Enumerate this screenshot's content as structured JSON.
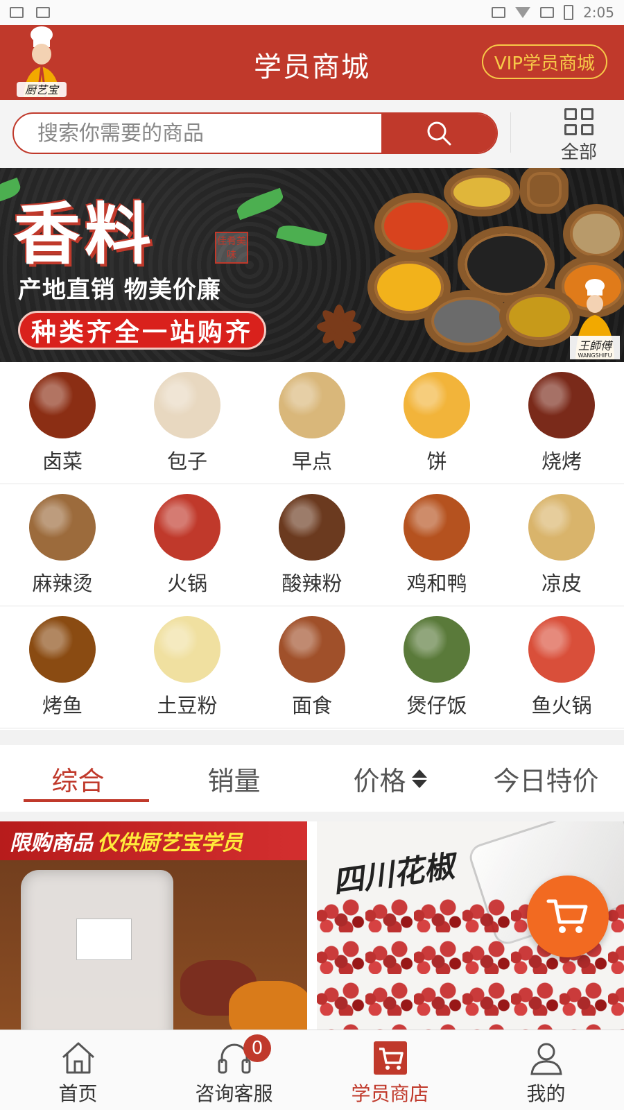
{
  "status_bar": {
    "time": "2:05"
  },
  "header": {
    "title": "学员商城",
    "vip_label": "VIP学员商城",
    "logo_text": "厨艺宝"
  },
  "search": {
    "placeholder": "搜索你需要的商品",
    "all_label": "全部"
  },
  "banner": {
    "title": "香料",
    "seal": "佳肴美味",
    "subtitle": "产地直销 物美价廉",
    "ribbon": "种类齐全一站购齐",
    "brand": "王師傅",
    "brand_en": "WANGSHIFU"
  },
  "categories": [
    [
      {
        "label": "卤菜",
        "color": "#8b2e14"
      },
      {
        "label": "包子",
        "color": "#e8d8c0"
      },
      {
        "label": "早点",
        "color": "#d9b77a"
      },
      {
        "label": "饼",
        "color": "#f2b43a"
      },
      {
        "label": "烧烤",
        "color": "#7a2a1a"
      }
    ],
    [
      {
        "label": "麻辣烫",
        "color": "#9c6b3c"
      },
      {
        "label": "火锅",
        "color": "#c0392b"
      },
      {
        "label": "酸辣粉",
        "color": "#6b3a1f"
      },
      {
        "label": "鸡和鸭",
        "color": "#b5521f"
      },
      {
        "label": "凉皮",
        "color": "#d9b46b"
      }
    ],
    [
      {
        "label": "烤鱼",
        "color": "#8a4b12"
      },
      {
        "label": "土豆粉",
        "color": "#f0e0a0"
      },
      {
        "label": "面食",
        "color": "#a0502a"
      },
      {
        "label": "煲仔饭",
        "color": "#5a7a3a"
      },
      {
        "label": "鱼火锅",
        "color": "#d94f3a"
      }
    ]
  ],
  "sort_tabs": [
    {
      "label": "综合",
      "active": true
    },
    {
      "label": "销量",
      "active": false
    },
    {
      "label": "价格",
      "active": false
    },
    {
      "label": "今日特价",
      "active": false
    }
  ],
  "products": {
    "left_promo": "限购商品",
    "left_promo_highlight": "仅供厨艺宝学员",
    "right_script": "四川花椒"
  },
  "bottom_nav": [
    {
      "label": "首页",
      "active": false
    },
    {
      "label": "咨询客服",
      "active": false,
      "badge": "0"
    },
    {
      "label": "学员商店",
      "active": true
    },
    {
      "label": "我的",
      "active": false
    }
  ],
  "colors": {
    "brand_red": "#c0392b",
    "vip_gold": "#f7c948",
    "cart_orange": "#f26a21"
  }
}
